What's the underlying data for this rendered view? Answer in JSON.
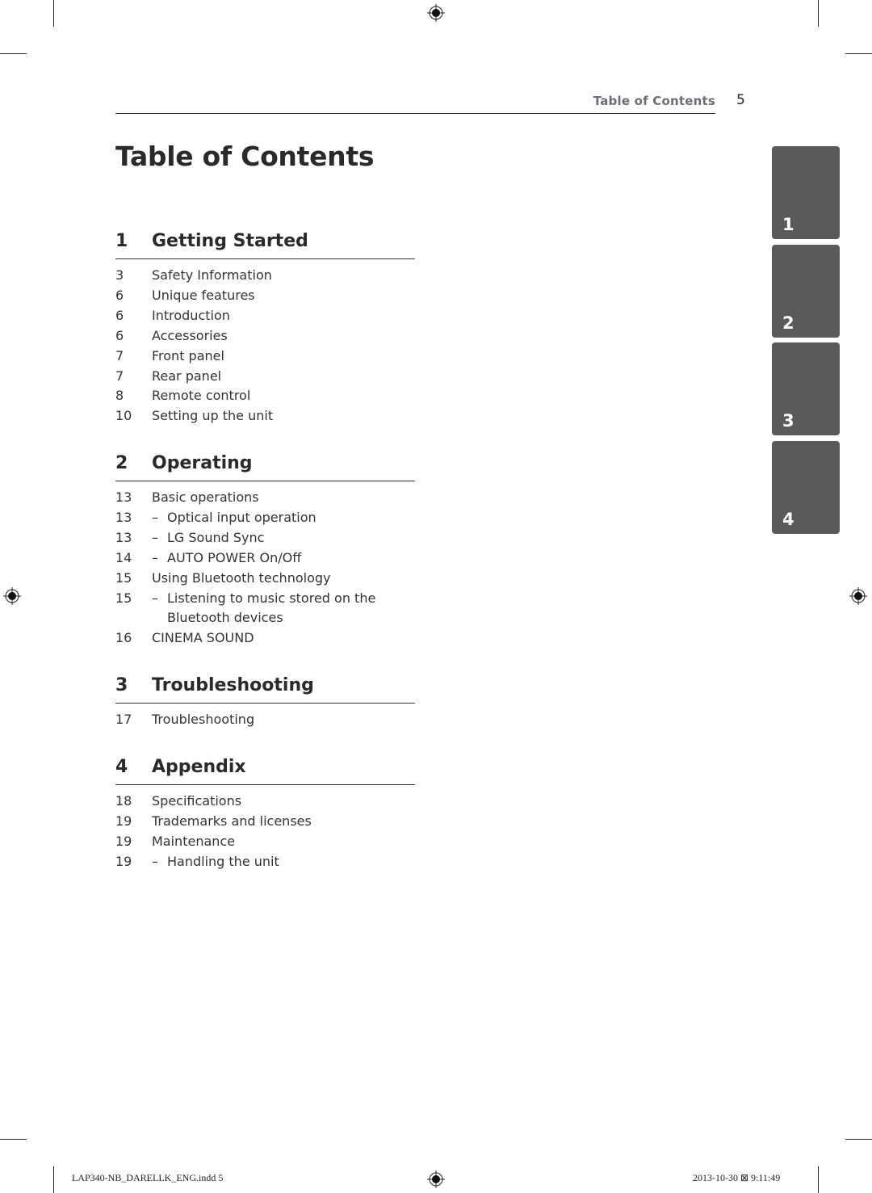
{
  "running_header": {
    "title": "Table of Contents",
    "page_number": "5"
  },
  "page_title": "Table of Contents",
  "sections": [
    {
      "number": "1",
      "title": "Getting Started",
      "entries": [
        {
          "page": "3",
          "text": "Safety Information",
          "sub": false
        },
        {
          "page": "6",
          "text": "Unique features",
          "sub": false
        },
        {
          "page": "6",
          "text": "Introduction",
          "sub": false
        },
        {
          "page": "6",
          "text": "Accessories",
          "sub": false
        },
        {
          "page": "7",
          "text": "Front panel",
          "sub": false
        },
        {
          "page": "7",
          "text": "Rear panel",
          "sub": false
        },
        {
          "page": "8",
          "text": "Remote control",
          "sub": false
        },
        {
          "page": "10",
          "text": "Setting up the unit",
          "sub": false
        }
      ]
    },
    {
      "number": "2",
      "title": "Operating",
      "entries": [
        {
          "page": "13",
          "text": "Basic operations",
          "sub": false
        },
        {
          "page": "13",
          "text": "Optical input operation",
          "sub": true
        },
        {
          "page": "13",
          "text": "LG Sound Sync",
          "sub": true
        },
        {
          "page": "14",
          "text": "AUTO POWER On/Off",
          "sub": true
        },
        {
          "page": "15",
          "text": "Using Bluetooth technology",
          "sub": false
        },
        {
          "page": "15",
          "text": "Listening to music stored on the",
          "sub": true
        },
        {
          "page": "",
          "text": "Bluetooth devices",
          "sub": true,
          "continuation": true
        },
        {
          "page": "16",
          "text": "CINEMA SOUND",
          "sub": false
        }
      ]
    },
    {
      "number": "3",
      "title": "Troubleshooting",
      "entries": [
        {
          "page": "17",
          "text": "Troubleshooting",
          "sub": false
        }
      ]
    },
    {
      "number": "4",
      "title": "Appendix",
      "entries": [
        {
          "page": "18",
          "text": "Specifications",
          "sub": false
        },
        {
          "page": "19",
          "text": "Trademarks and licenses",
          "sub": false
        },
        {
          "page": "19",
          "text": "Maintenance",
          "sub": false
        },
        {
          "page": "19",
          "text": "Handling the unit",
          "sub": true
        }
      ]
    }
  ],
  "dash_glyph": "–",
  "side_tabs": [
    "1",
    "2",
    "3",
    "4"
  ],
  "slug": {
    "file": "LAP340-NB_DARELLK_ENG.indd   5",
    "timestamp": "2013-10-30   ⊠ 9:11:49"
  },
  "colors": {
    "tab_bg": "#5a5a5c",
    "running_title": "#6a6e78"
  }
}
